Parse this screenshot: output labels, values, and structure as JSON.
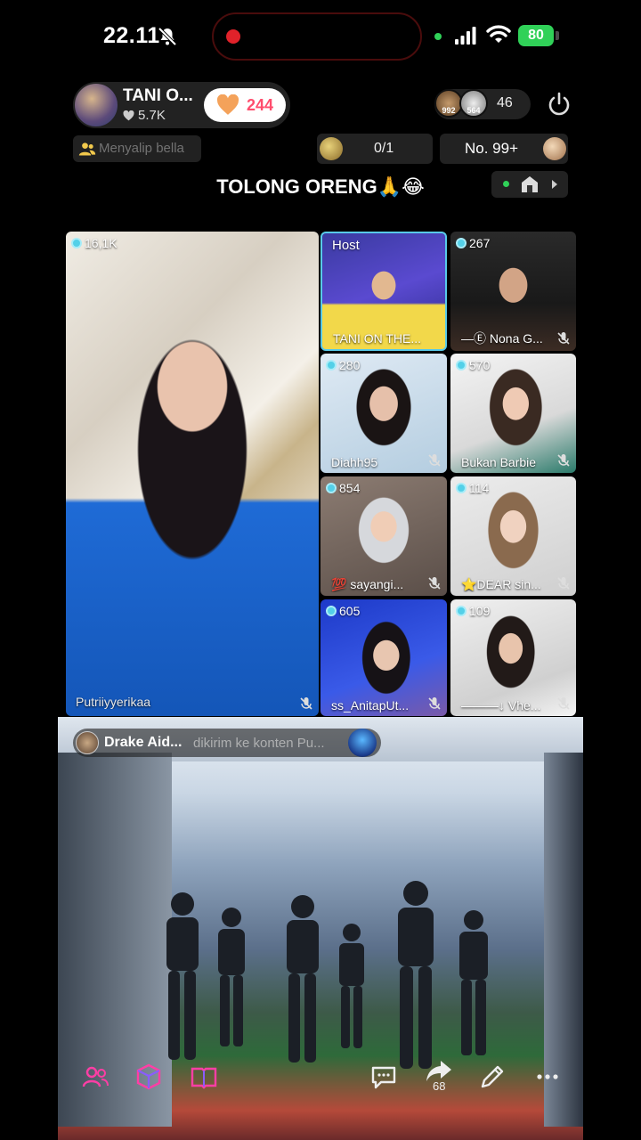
{
  "status_bar": {
    "time": "22.11",
    "battery": "80"
  },
  "host": {
    "name": "TANI O...",
    "likes": "5.7K",
    "like_button_count": "244"
  },
  "viewers": {
    "avatar_1_badge": "992",
    "avatar_2_badge": "564",
    "count": "46"
  },
  "goal": {
    "text": "Menyalip bella"
  },
  "rank": {
    "value": "0/1"
  },
  "daily_rank": {
    "label": "No. 99+"
  },
  "title": "TOLONG ORENG🙏😂",
  "tiles": [
    {
      "viewers": "16,1K",
      "name": "Putriiyyerikaa"
    },
    {
      "label": "Host",
      "name": "TANI ON THE..."
    },
    {
      "viewers": "267",
      "name": "—Ⓔ Nona G..."
    },
    {
      "viewers": "280",
      "name": "Diahh95"
    },
    {
      "viewers": "570",
      "name": "Bukan Barbie"
    },
    {
      "viewers": "854",
      "name": "💯 sayangi..."
    },
    {
      "viewers": "114",
      "name": "⭐DEAR sin..."
    },
    {
      "viewers": "605",
      "name": "ss_AnitapUt..."
    },
    {
      "viewers": "109",
      "name": "———↓ Vhe..."
    }
  ],
  "comment": {
    "user": "Drake Aid...",
    "text": "dikirim ke konten Pu..."
  },
  "toolbar": {
    "share_count": "68"
  },
  "colors": {
    "like": "#ff4d6d",
    "host_border": "#58c9e8",
    "battery": "#30d158",
    "recording": "#e0222a",
    "toolbar_pink": "#ff3ea5",
    "toolbar_violet": "#8a5cff"
  },
  "icons": [
    "bell-off-icon",
    "signal-icon",
    "wifi-icon",
    "heart-icon",
    "power-icon",
    "people-icon",
    "home-icon",
    "eye-icon",
    "mic-off-icon",
    "guests-icon",
    "cube-icon",
    "book-icon",
    "chat-icon",
    "share-icon",
    "pencil-icon",
    "more-icon"
  ]
}
